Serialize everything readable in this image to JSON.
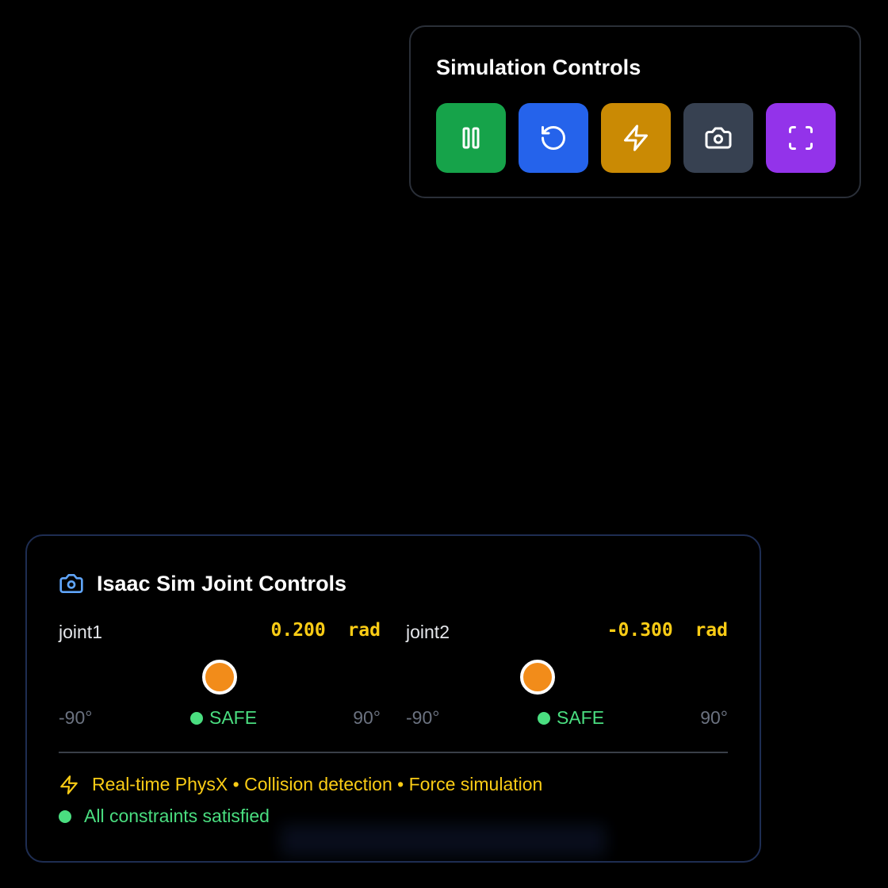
{
  "sim_controls": {
    "title": "Simulation Controls",
    "buttons": [
      {
        "name": "pause",
        "icon": "pause-icon",
        "color": "#16a34a"
      },
      {
        "name": "reset",
        "icon": "rotate-ccw-icon",
        "color": "#2563eb"
      },
      {
        "name": "apply-force",
        "icon": "zap-icon",
        "color": "#ca8a04"
      },
      {
        "name": "capture",
        "icon": "camera-icon",
        "color": "#374151"
      },
      {
        "name": "fullscreen",
        "icon": "scan-icon",
        "color": "#9333ea"
      }
    ]
  },
  "joint_controls": {
    "title": "Isaac Sim Joint Controls",
    "header_icon": "camera-icon",
    "joints": [
      {
        "name": "joint1",
        "value": "0.200",
        "unit": "rad",
        "min_label": "-90°",
        "max_label": "90°",
        "status": "SAFE",
        "position_fraction": 0.5
      },
      {
        "name": "joint2",
        "value": "-0.300",
        "unit": "rad",
        "min_label": "-90°",
        "max_label": "90°",
        "status": "SAFE",
        "position_fraction": 0.41
      }
    ],
    "features_icon": "zap-icon",
    "features": "Real-time PhysX • Collision detection • Force simulation",
    "status_text": "All constraints satisfied"
  },
  "colors": {
    "accent_yellow": "#facc15",
    "safe_green": "#4ade80",
    "thumb_orange": "#f28c1a",
    "header_icon_blue": "#60a5fa"
  }
}
